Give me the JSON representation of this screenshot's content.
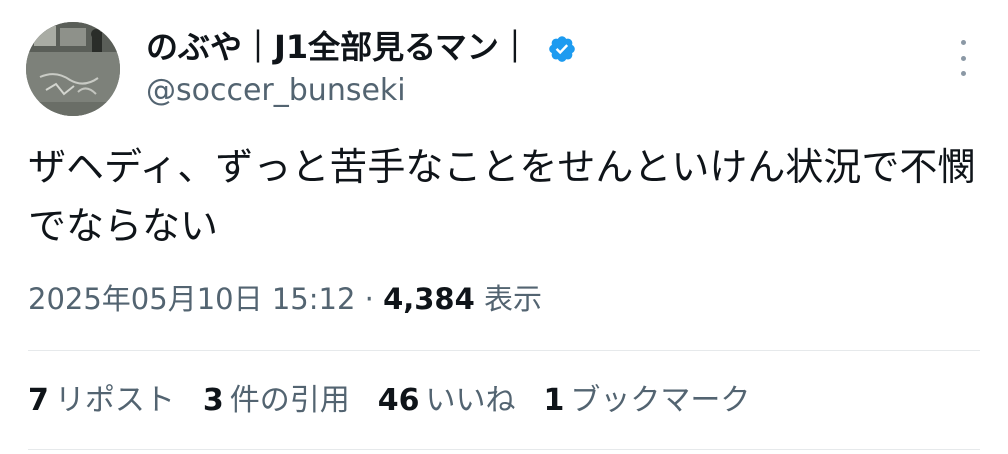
{
  "author": {
    "name": "のぶや｜J1全部見るマン｜",
    "handle": "@soccer_bunseki",
    "verified": true,
    "verified_color": "#1d9bf0"
  },
  "tweet": {
    "text": "ザヘディ、ずっと苦手なことをせんといけん状況で不憫でならない",
    "timestamp": "2025年05月10日 15:12",
    "separator": "·",
    "views_count": "4,384",
    "views_label": "表示"
  },
  "stats": [
    {
      "count": "7",
      "label": "リポスト"
    },
    {
      "count": "3",
      "label": "件の引用"
    },
    {
      "count": "46",
      "label": "いいね"
    },
    {
      "count": "1",
      "label": "ブックマーク"
    }
  ],
  "colors": {
    "text": "#0f1419",
    "secondary": "#536471",
    "divider": "#e6e9eb"
  }
}
